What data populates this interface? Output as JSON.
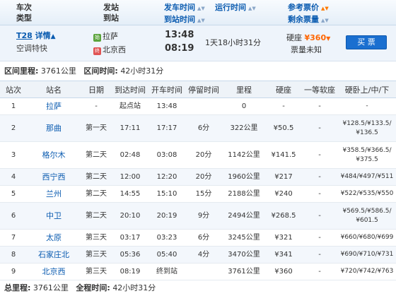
{
  "header": {
    "col_train": [
      "车次",
      "类型"
    ],
    "col_station": [
      "发站",
      "到站"
    ],
    "col_time": [
      "发车时间",
      "到站时间"
    ],
    "col_duration": "运行时间",
    "col_price": [
      "参考票价",
      "剩余票量"
    ]
  },
  "train": {
    "code": "T28",
    "detail_link": "详情",
    "detail_icon": "triangle-up",
    "type": "空调特快",
    "from_station": "拉萨",
    "from_badge": "始",
    "to_station": "北京西",
    "to_badge": "终",
    "depart_time": "13:48",
    "arrive_time": "08:19",
    "duration": "1天18小时31分",
    "seat_label": "硬座",
    "price": "¥360",
    "ticket_status": "票量未知",
    "buy_label": "买 票",
    "accent_color": "#1a6fd0",
    "price_color": "#ff6600"
  },
  "summary": {
    "range_label": "区间里程:",
    "range_value": "3761公里",
    "time_label": "区间时间:",
    "time_value": "42小时31分"
  },
  "table": {
    "headers": [
      "站次",
      "站名",
      "日期",
      "到达时间",
      "开车时间",
      "停留时间",
      "里程",
      "硬座",
      "一等软座",
      "硬卧上/中/下"
    ],
    "rows": [
      {
        "no": "1",
        "name": "拉萨",
        "day": "-",
        "arrive": "起点站",
        "depart": "13:48",
        "stop": "",
        "km": "0",
        "hard": "-",
        "first": "-",
        "sleeper": "-"
      },
      {
        "no": "2",
        "name": "那曲",
        "day": "第一天",
        "arrive": "17:11",
        "depart": "17:17",
        "stop": "6分",
        "km": "322公里",
        "hard": "¥50.5",
        "first": "-",
        "sleeper": "¥128.5/¥133.5/ ¥136.5"
      },
      {
        "no": "3",
        "name": "格尔木",
        "day": "第二天",
        "arrive": "02:48",
        "depart": "03:08",
        "stop": "20分",
        "km": "1142公里",
        "hard": "¥141.5",
        "first": "-",
        "sleeper": "¥358.5/¥366.5/ ¥375.5"
      },
      {
        "no": "4",
        "name": "西宁西",
        "day": "第二天",
        "arrive": "12:00",
        "depart": "12:20",
        "stop": "20分",
        "km": "1960公里",
        "hard": "¥217",
        "first": "-",
        "sleeper": "¥484/¥497/¥511"
      },
      {
        "no": "5",
        "name": "兰州",
        "day": "第二天",
        "arrive": "14:55",
        "depart": "15:10",
        "stop": "15分",
        "km": "2188公里",
        "hard": "¥240",
        "first": "-",
        "sleeper": "¥522/¥535/¥550"
      },
      {
        "no": "6",
        "name": "中卫",
        "day": "第二天",
        "arrive": "20:10",
        "depart": "20:19",
        "stop": "9分",
        "km": "2494公里",
        "hard": "¥268.5",
        "first": "-",
        "sleeper": "¥569.5/¥586.5/ ¥601.5"
      },
      {
        "no": "7",
        "name": "太原",
        "day": "第三天",
        "arrive": "03:17",
        "depart": "03:23",
        "stop": "6分",
        "km": "3245公里",
        "hard": "¥321",
        "first": "-",
        "sleeper": "¥660/¥680/¥699"
      },
      {
        "no": "8",
        "name": "石家庄北",
        "day": "第三天",
        "arrive": "05:36",
        "depart": "05:40",
        "stop": "4分",
        "km": "3470公里",
        "hard": "¥341",
        "first": "-",
        "sleeper": "¥690/¥710/¥731"
      },
      {
        "no": "9",
        "name": "北京西",
        "day": "第三天",
        "arrive": "08:19",
        "depart": "终到站",
        "stop": "",
        "km": "3761公里",
        "hard": "¥360",
        "first": "-",
        "sleeper": "¥720/¥742/¥763"
      }
    ]
  },
  "footer": {
    "total_km_label": "总里程:",
    "total_km_value": "3761公里",
    "total_time_label": "全程时间:",
    "total_time_value": "42小时31分"
  }
}
